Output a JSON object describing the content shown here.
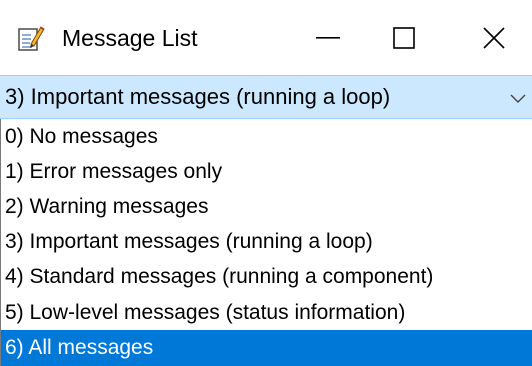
{
  "window": {
    "title": "Message List",
    "app_icon": "notepad-pencil-icon",
    "controls": {
      "minimize_icon": "minimize-icon",
      "maximize_icon": "maximize-icon",
      "close_icon": "close-icon"
    }
  },
  "combo": {
    "selected_value": "3) Important messages (running a loop)",
    "arrow_icon": "chevron-down-icon"
  },
  "list": {
    "items": [
      {
        "label": "0) No messages",
        "selected": false
      },
      {
        "label": "1) Error messages only",
        "selected": false
      },
      {
        "label": "2) Warning messages",
        "selected": false
      },
      {
        "label": "3) Important messages (running a loop)",
        "selected": false
      },
      {
        "label": "4) Standard messages (running a component)",
        "selected": false
      },
      {
        "label": "5) Low-level messages (status information)",
        "selected": false
      },
      {
        "label": "6) All messages",
        "selected": true
      }
    ]
  },
  "colors": {
    "combo_background": "#cce8ff",
    "selection_background": "#0078d7",
    "selection_text": "#ffffff"
  }
}
